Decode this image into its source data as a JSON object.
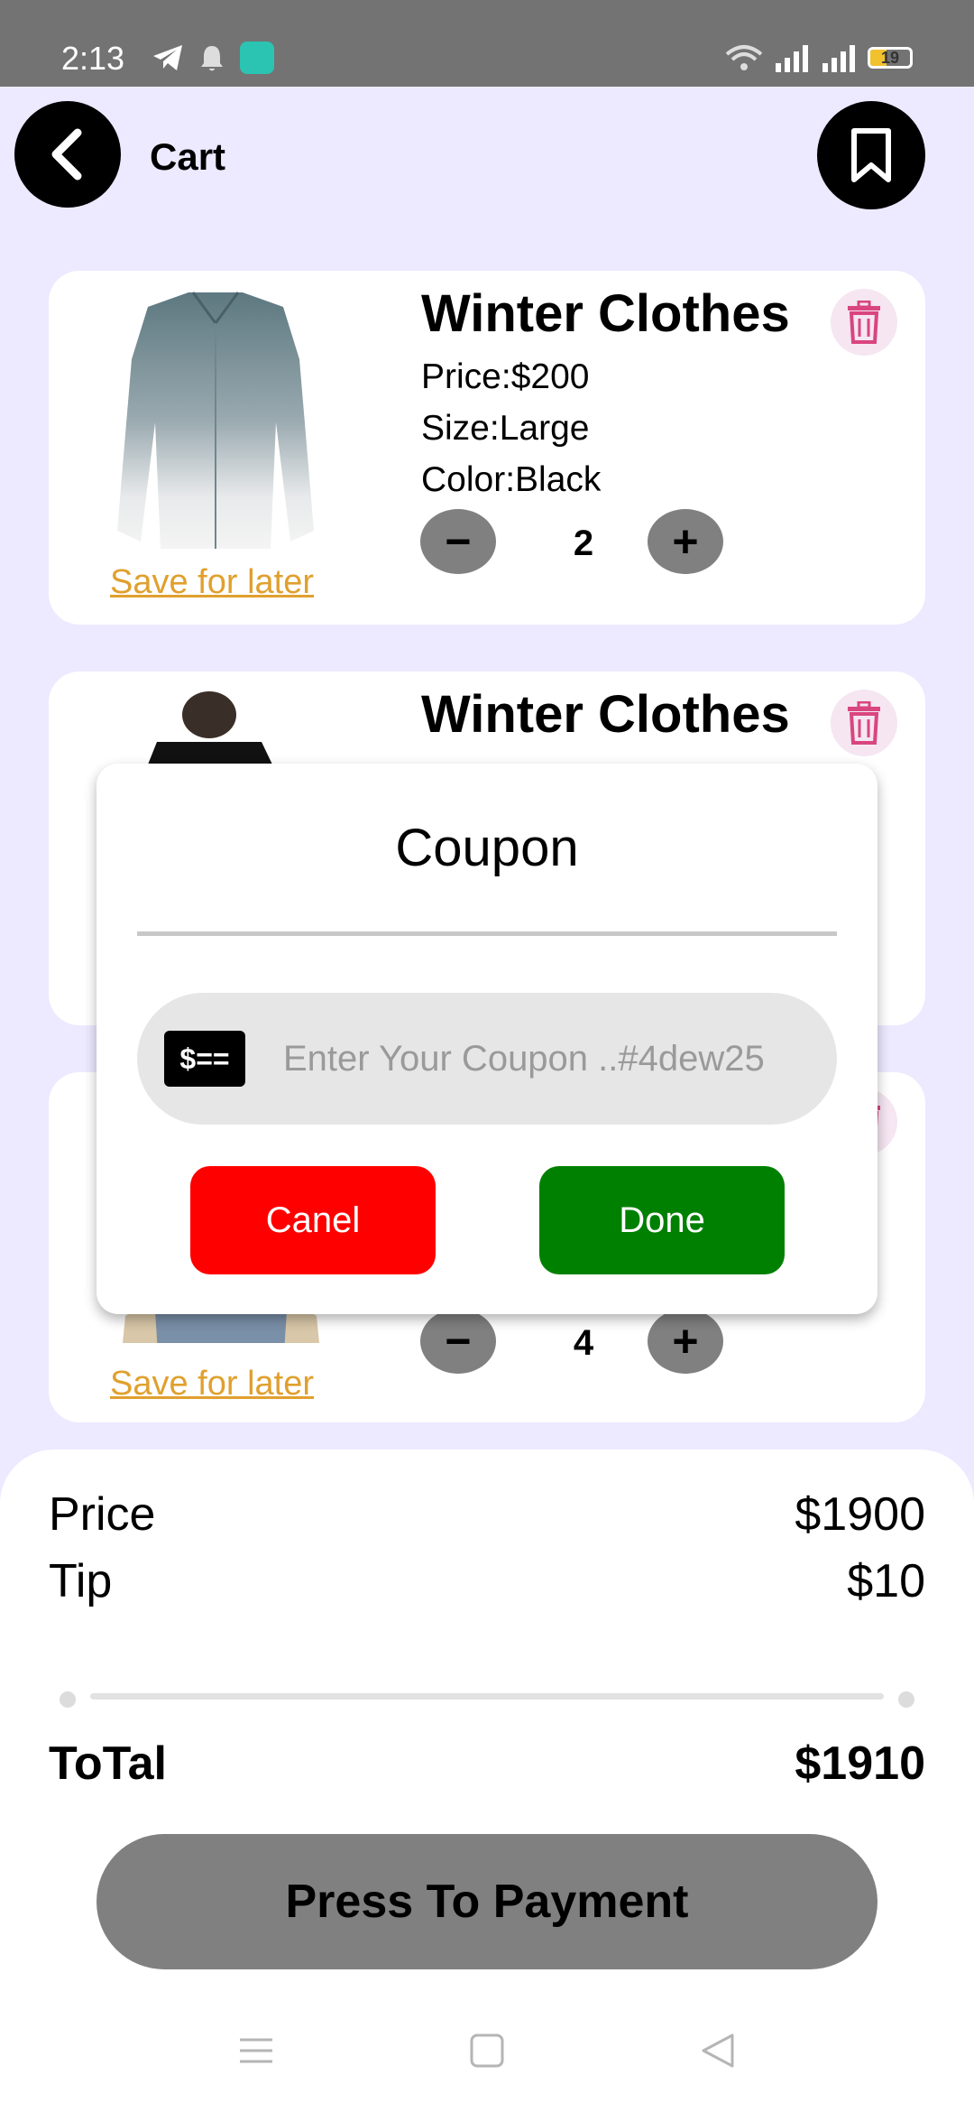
{
  "status_bar": {
    "time": "2:13",
    "battery": "19",
    "battery_level": 0.19,
    "icons": [
      "telegram-icon",
      "bell-icon",
      "app-icon",
      "wifi-icon",
      "signal-icon",
      "signal-icon",
      "battery-icon"
    ]
  },
  "header": {
    "title": "Cart",
    "back_icon": "chevron-left-icon",
    "bookmark_icon": "bookmark-icon"
  },
  "cart_items": [
    {
      "title": "Winter Clothes",
      "price": "Price:$200",
      "size": "Size:Large",
      "color": "Color:Black",
      "quantity": "2",
      "save_label": "Save for later"
    },
    {
      "title": "Winter Clothes"
    },
    {
      "quantity": "4",
      "save_label": "Save for later"
    }
  ],
  "qty_controls": {
    "minus": "−",
    "plus": "+"
  },
  "summary": {
    "price_label": "Price",
    "price_value": "$1900",
    "tip_label": "Tip",
    "tip_value": "$10",
    "total_label": "ToTal",
    "total_value": "$1910",
    "pay_label": "Press To Payment"
  },
  "dialog": {
    "title": "Coupon",
    "coupon_icon_text": "$==",
    "placeholder": "Enter Your Coupon ..#4dew25",
    "value": "",
    "cancel_label": "Canel",
    "done_label": "Done"
  },
  "colors": {
    "background": "#ede9ff",
    "cancel": "#ff0000",
    "done": "#008000",
    "save_link": "#e0a02e",
    "trash": "#d9467f",
    "pay_button": "#808080"
  },
  "nav": [
    "menu-icon",
    "home-square-icon",
    "back-triangle-icon"
  ]
}
